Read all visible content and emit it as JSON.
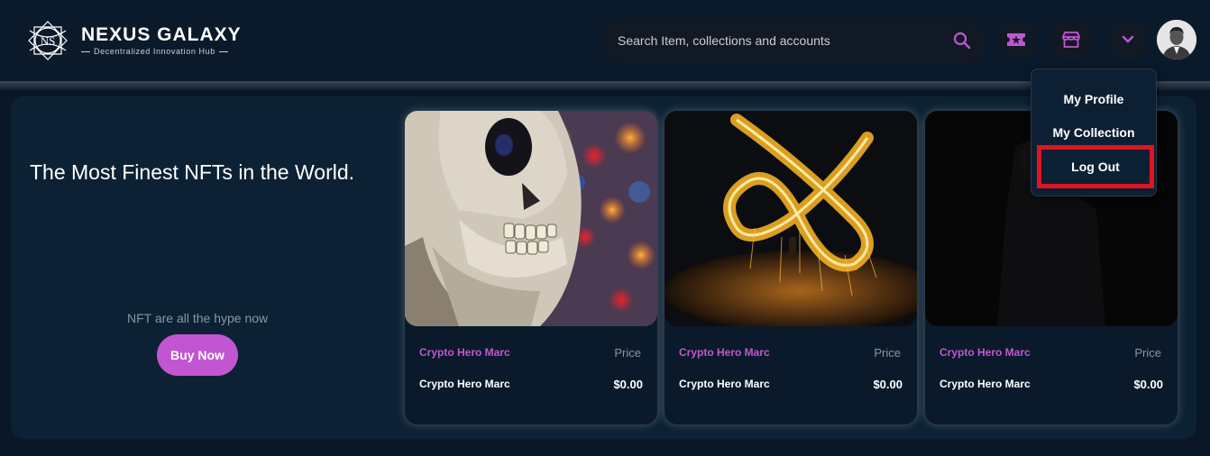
{
  "brand": {
    "title": "NEXUS GALAXY",
    "subtitle": "Decentralized Innovation Hub",
    "mark_text": "NS"
  },
  "search": {
    "placeholder": "Search Item, collections and accounts"
  },
  "header_icons": [
    "ticket-icon",
    "store-icon",
    "chevron-down-icon"
  ],
  "colors": {
    "accent": "#c256d2",
    "background": "#0a1726",
    "panel": "#0d2135",
    "highlight_box": "#e0141e"
  },
  "hero": {
    "title": "The Most Finest NFTs in the World.",
    "subtitle": "NFT are all the hype now",
    "cta_label": "Buy Now"
  },
  "cards": [
    {
      "name": "Crypto Hero Marc",
      "price_label": "Price",
      "owner": "Crypto Hero Marc",
      "price": "$0.00",
      "image": "skull-photo"
    },
    {
      "name": "Crypto Hero Marc",
      "price_label": "Price",
      "owner": "Crypto Hero Marc",
      "price": "$0.00",
      "image": "fire-infinity-photo"
    },
    {
      "name": "Crypto Hero Marc",
      "price_label": "Price",
      "owner": "Crypto Hero Marc",
      "price": "$0.00",
      "image": "dark-figure-photo"
    }
  ],
  "user_menu": {
    "items": [
      "My Profile",
      "My Collection",
      "Log Out"
    ]
  }
}
